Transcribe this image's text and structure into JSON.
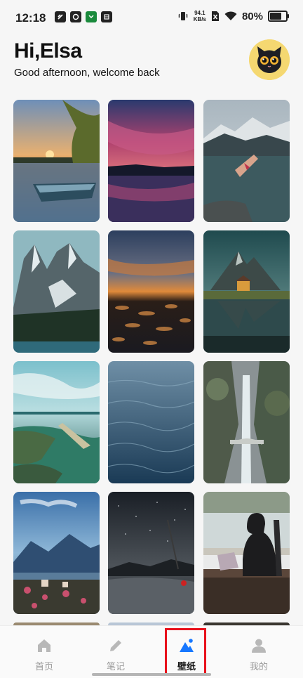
{
  "status_bar": {
    "time": "12:18",
    "net_speed_value": "94.1",
    "net_speed_unit": "KB/s",
    "battery_percent": "80%",
    "battery_level": 0.8
  },
  "header": {
    "greeting": "Hi,Elsa",
    "subtitle": "Good afternoon, welcome back"
  },
  "wallpapers": [
    {
      "name": "lake-sunset-boat"
    },
    {
      "name": "pink-sky-lake"
    },
    {
      "name": "cliff-dive-mountains"
    },
    {
      "name": "snowy-peaks-forest"
    },
    {
      "name": "sunset-lily-pond"
    },
    {
      "name": "mountain-cabin-lake"
    },
    {
      "name": "aerial-lagoon"
    },
    {
      "name": "ocean-water-surface"
    },
    {
      "name": "waterfall-bridge"
    },
    {
      "name": "mountain-lake-village"
    },
    {
      "name": "night-stars-shore"
    },
    {
      "name": "man-laptop-window"
    }
  ],
  "bottom_nav": {
    "active_index": 2,
    "items": [
      {
        "label": "首页",
        "icon": "home-icon"
      },
      {
        "label": "笔记",
        "icon": "pencil-icon"
      },
      {
        "label": "壁纸",
        "icon": "mountain-icon"
      },
      {
        "label": "我的",
        "icon": "person-icon"
      }
    ]
  },
  "colors": {
    "highlight": "#e8111c",
    "active_icon": "#1677ff",
    "inactive": "#b8b8b8"
  }
}
